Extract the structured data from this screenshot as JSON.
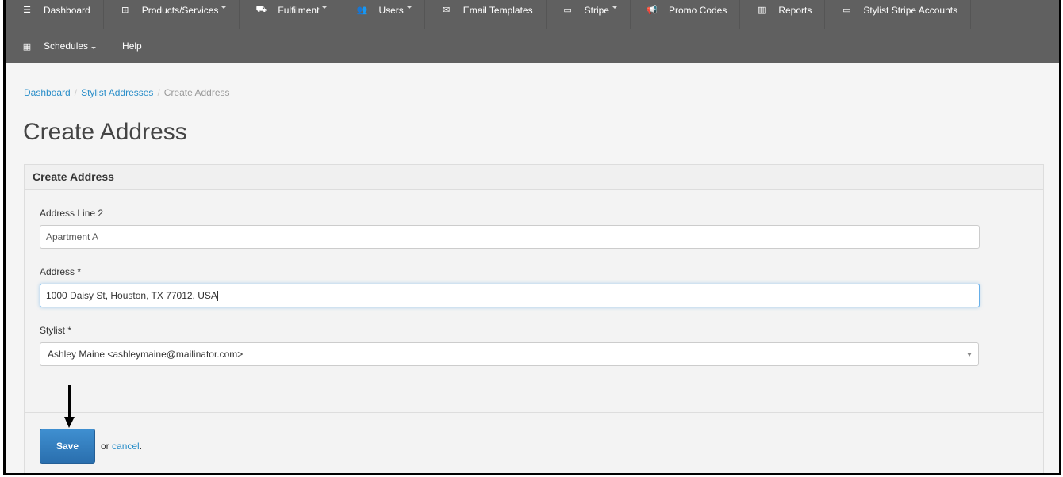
{
  "nav": {
    "row1": [
      {
        "icon": "list-icon",
        "glyph": "☰",
        "label": "Dashboard",
        "caret": false
      },
      {
        "icon": "sitemap-icon",
        "glyph": "⊞",
        "label": "Products/Services",
        "caret": true
      },
      {
        "icon": "cart-icon",
        "glyph": "⛟",
        "label": "Fulfilment",
        "caret": true
      },
      {
        "icon": "users-icon",
        "glyph": "👥",
        "label": "Users",
        "caret": true
      },
      {
        "icon": "envelope-icon",
        "glyph": "✉",
        "label": "Email Templates",
        "caret": false
      },
      {
        "icon": "credit-card-icon",
        "glyph": "▭",
        "label": "Stripe",
        "caret": true
      },
      {
        "icon": "bullhorn-icon",
        "glyph": "📢",
        "label": "Promo Codes",
        "caret": false
      },
      {
        "icon": "bar-chart-icon",
        "glyph": "▥",
        "label": "Reports",
        "caret": false
      },
      {
        "icon": "credit-card-icon",
        "glyph": "▭",
        "label": "Stylist Stripe Accounts",
        "caret": false
      }
    ],
    "row2": [
      {
        "icon": "calendar-icon",
        "glyph": "▦",
        "label": "Schedules",
        "caret": true
      },
      {
        "label": "Help",
        "caret": false
      }
    ]
  },
  "breadcrumb": {
    "dashboard": "Dashboard",
    "stylist_addresses": "Stylist Addresses",
    "current": "Create Address"
  },
  "page_title": "Create Address",
  "panel": {
    "heading": "Create Address",
    "address_line2_label": "Address Line 2",
    "address_line2_value": "Apartment A",
    "address_label": "Address *",
    "address_value": "1000 Daisy St, Houston, TX 77012, USA",
    "stylist_label": "Stylist *",
    "stylist_value": "Ashley Maine <ashleymaine@mailinator.com>",
    "save_label": "Save",
    "or_text": "or",
    "cancel_label": "cancel",
    "period": "."
  }
}
